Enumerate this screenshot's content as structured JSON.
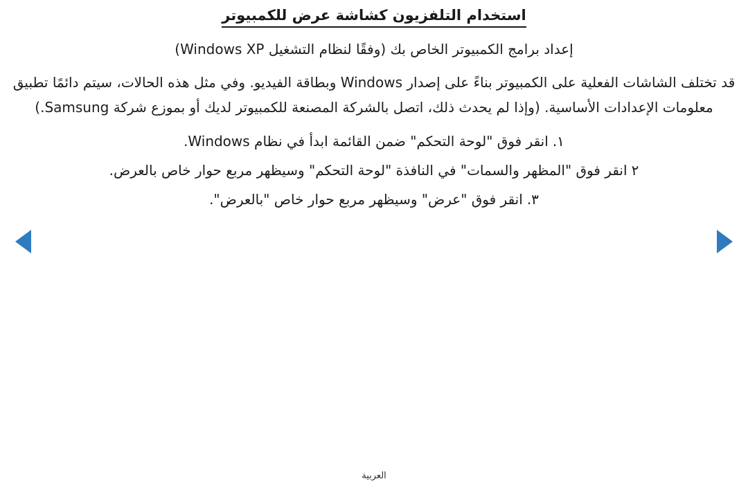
{
  "document": {
    "title": "استخدام التلفزيون كشاشة عرض للكمبيوتر",
    "intro": "إعداد برامج الكمبيوتر الخاص بك (وفقًا لنظام التشغيل Windows XP)",
    "note": "قد تختلف الشاشات الفعلية على الكمبيوتر بناءً على إصدار Windows وبطاقة الفيديو. وفي مثل هذه الحالات، سيتم دائمًا تطبيق معلومات الإعدادات الأساسية. (وإذا لم يحدث ذلك، اتصل بالشركة المصنعة للكمبيوتر لديك أو بموزع شركة Samsung.)",
    "steps": [
      {
        "marker": "١.",
        "text": "انقر فوق \"لوحة التحكم\" ضمن القائمة ابدأ في نظام Windows."
      },
      {
        "marker": "٢",
        "text": "انقر فوق \"المظهر والسمات\" في النافذة \"لوحة التحكم\" وسيظهر مربع حوار خاص بالعرض."
      },
      {
        "marker": "٣.",
        "text": "انقر فوق \"عرض\" وسيظهر مربع حوار خاص \"بالعرض\"."
      }
    ]
  },
  "navigation": {
    "previous_label": "◀",
    "next_label": "▶",
    "accent_color": "#2e7bbf"
  },
  "footer": {
    "language": "العربية"
  }
}
